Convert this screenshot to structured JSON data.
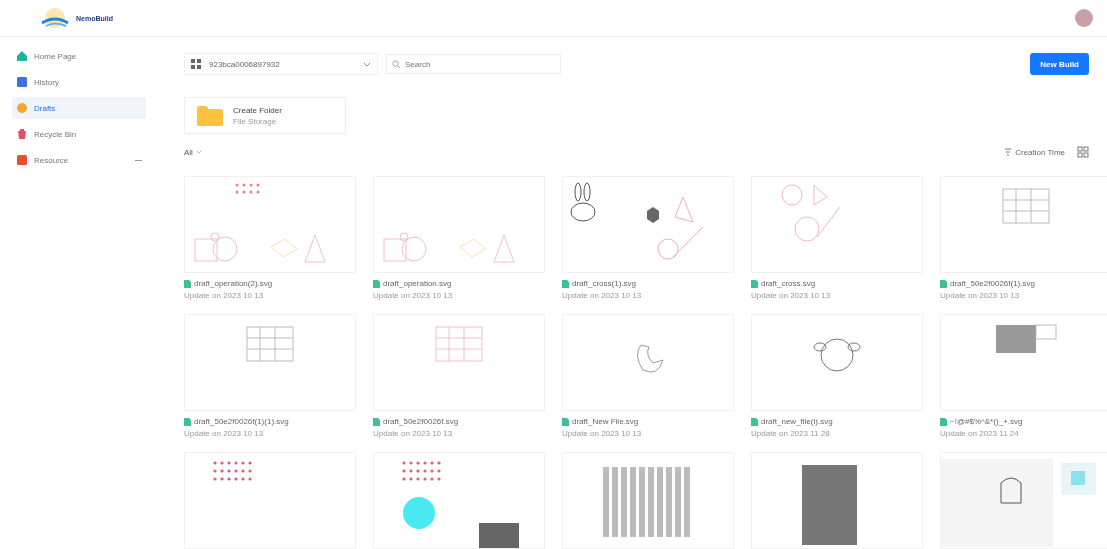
{
  "header": {
    "logo_text": "NemoBuild"
  },
  "sidebar": {
    "items": [
      {
        "label": "Home Page",
        "selected": false,
        "has_submenu": false
      },
      {
        "label": "History",
        "selected": false,
        "has_submenu": false
      },
      {
        "label": "Drafts",
        "selected": true,
        "has_submenu": false
      },
      {
        "label": "Recycle Bin",
        "selected": false,
        "has_submenu": false
      },
      {
        "label": "Resource",
        "selected": false,
        "has_submenu": true
      }
    ]
  },
  "toolbar": {
    "workspace": "923bca0006897932",
    "search": {
      "placeholder": "Search"
    },
    "new_button": "New Build"
  },
  "create_folder": {
    "title": "Create Folder",
    "subtitle": "File Storage"
  },
  "filter": {
    "label": "All",
    "sort": "Creation Time"
  },
  "files": [
    {
      "name": "draft_operation(2).svg",
      "updated": "Update on 2023 10 13"
    },
    {
      "name": "draft_operation.svg",
      "updated": "Update on 2023 10 13"
    },
    {
      "name": "draft_cross(1).svg",
      "updated": "Update on 2023 10 13"
    },
    {
      "name": "draft_cross.svg",
      "updated": "Update on 2023 10 13"
    },
    {
      "name": "draft_50e2f0026f(1).svg",
      "updated": "Update on 2023 10 13"
    },
    {
      "name": "draft_50e2f0026f(1)(1).svg",
      "updated": "Update on 2023 10 13"
    },
    {
      "name": "draft_50e2f0026f.svg",
      "updated": "Update on 2023 10 13"
    },
    {
      "name": "draft_New File.svg",
      "updated": "Update on 2023 10 13"
    },
    {
      "name": "draft_new_file(i).svg",
      "updated": "Update on 2023 11 28"
    },
    {
      "name": "~!@#$%^&*()_+.svg",
      "updated": "Update on 2023 11 24"
    }
  ]
}
